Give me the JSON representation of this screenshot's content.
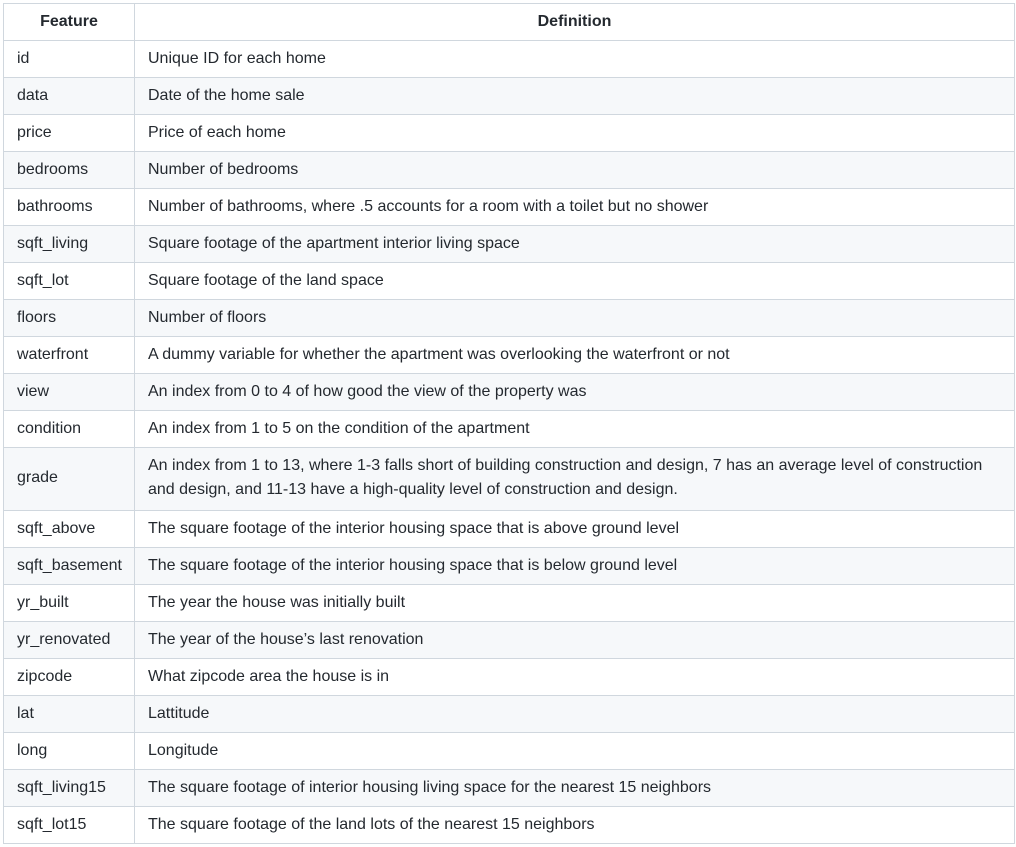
{
  "table": {
    "headers": [
      "Feature",
      "Definition"
    ],
    "rows": [
      {
        "feature": "id",
        "definition": "Unique ID for each home"
      },
      {
        "feature": "data",
        "definition": "Date of the home sale"
      },
      {
        "feature": "price",
        "definition": "Price of each home"
      },
      {
        "feature": "bedrooms",
        "definition": "Number of bedrooms"
      },
      {
        "feature": "bathrooms",
        "definition": "Number of bathrooms, where .5 accounts for a room with a toilet but no shower"
      },
      {
        "feature": "sqft_living",
        "definition": "Square footage of the apartment interior living space"
      },
      {
        "feature": "sqft_lot",
        "definition": "Square footage of the land space"
      },
      {
        "feature": "floors",
        "definition": "Number of floors"
      },
      {
        "feature": "waterfront",
        "definition": "A dummy variable for whether the apartment was overlooking the waterfront or not"
      },
      {
        "feature": "view",
        "definition": "An index from 0 to 4 of how good the view of the property was"
      },
      {
        "feature": "condition",
        "definition": "An index from 1 to 5 on the condition of the apartment"
      },
      {
        "feature": "grade",
        "definition": "An index from 1 to 13, where 1-3 falls short of building construction and design, 7 has an average level of construction and design, and 11-13 have a high-quality level of construction and design."
      },
      {
        "feature": "sqft_above",
        "definition": "The square footage of the interior housing space that is above ground level"
      },
      {
        "feature": "sqft_basement",
        "definition": "The square footage of the interior housing space that is below ground level"
      },
      {
        "feature": "yr_built",
        "definition": "The year the house was initially built"
      },
      {
        "feature": "yr_renovated",
        "definition": "The year of the house’s last renovation"
      },
      {
        "feature": "zipcode",
        "definition": "What zipcode area the house is in"
      },
      {
        "feature": "lat",
        "definition": "Lattitude"
      },
      {
        "feature": "long",
        "definition": "Longitude"
      },
      {
        "feature": "sqft_living15",
        "definition": "The square footage of interior housing living space for the nearest 15 neighbors"
      },
      {
        "feature": "sqft_lot15",
        "definition": "The square footage of the land lots of the nearest 15 neighbors"
      }
    ]
  }
}
